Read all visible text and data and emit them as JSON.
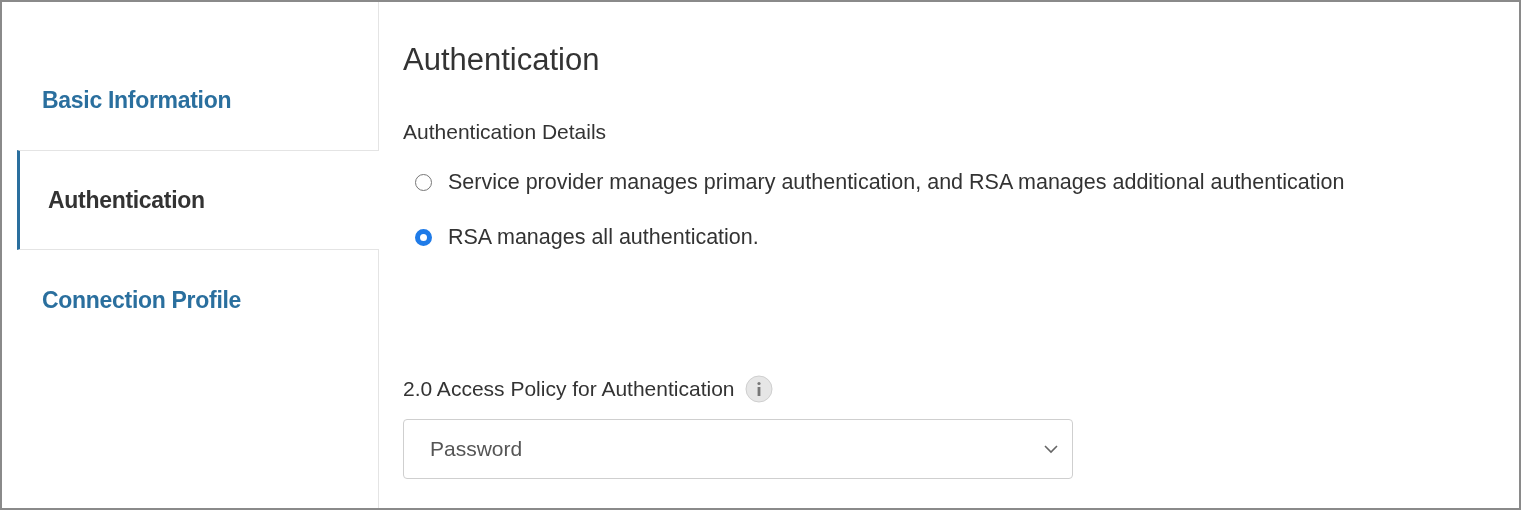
{
  "sidebar": {
    "tabs": [
      {
        "label": "Basic Information",
        "selected": false
      },
      {
        "label": "Authentication",
        "selected": true
      },
      {
        "label": "Connection Profile",
        "selected": false
      }
    ]
  },
  "main": {
    "title": "Authentication",
    "section_label": "Authentication Details",
    "options": [
      {
        "label": "Service provider manages primary authentication, and RSA manages additional authentication",
        "selected": false
      },
      {
        "label": "RSA manages all authentication.",
        "selected": true
      }
    ],
    "policy": {
      "label": "2.0 Access Policy for Authentication",
      "value": "Password"
    }
  }
}
